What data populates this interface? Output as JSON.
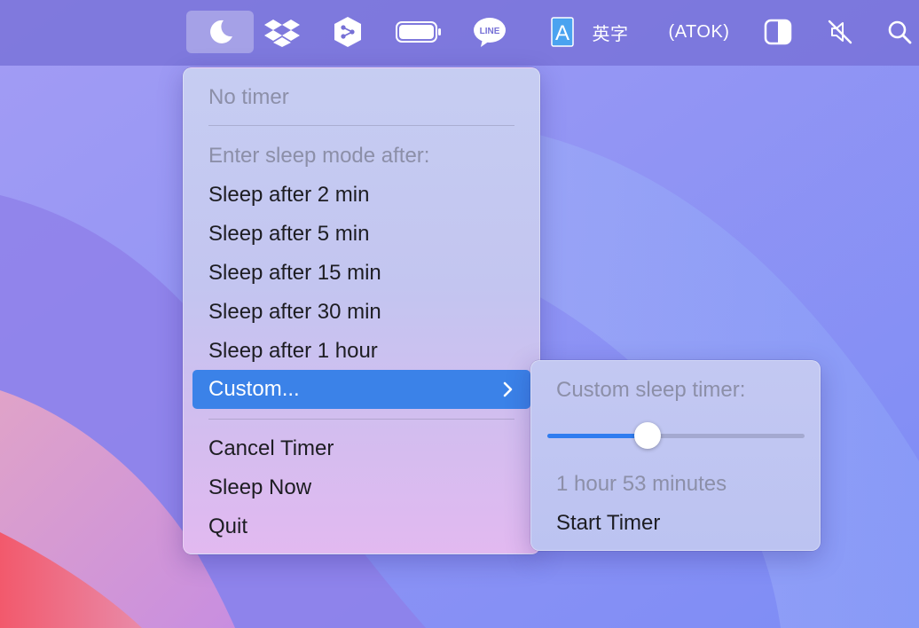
{
  "menubar": {
    "items": [
      {
        "icon": "moon-icon",
        "active": true
      },
      {
        "icon": "dropbox-icon"
      },
      {
        "icon": "share-app-icon"
      },
      {
        "icon": "battery-icon"
      },
      {
        "icon": "line-app-icon",
        "label": "LINE"
      },
      {
        "icon": "input-method-icon",
        "label": "A"
      },
      {
        "label": "英字"
      },
      {
        "label": "(ATOK)"
      },
      {
        "icon": "display-contrast-icon"
      },
      {
        "icon": "mute-icon"
      },
      {
        "icon": "search-icon"
      }
    ]
  },
  "menu": {
    "status": "No timer",
    "section_header": "Enter sleep mode after:",
    "options": [
      "Sleep after 2 min",
      "Sleep after 5 min",
      "Sleep after 15 min",
      "Sleep after 30 min",
      "Sleep after 1 hour"
    ],
    "custom_label": "Custom...",
    "cancel_label": "Cancel Timer",
    "sleep_now_label": "Sleep Now",
    "quit_label": "Quit"
  },
  "submenu": {
    "header": "Custom sleep timer:",
    "slider_fraction": 0.39,
    "duration_text": "1 hour 53 minutes",
    "start_label": "Start Timer"
  },
  "colors": {
    "highlight": "#3b82e8",
    "slider_fill": "#2f7cf0",
    "menubar": "#7670d6"
  }
}
